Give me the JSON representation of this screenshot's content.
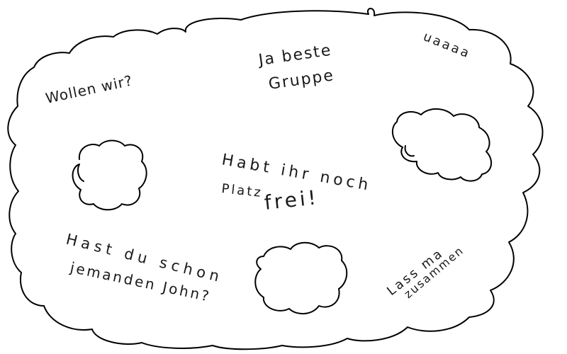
{
  "canvas": {
    "background": "#ffffff",
    "stroke_color": "#000000",
    "ink_color": "#1a1a1a"
  },
  "notes": {
    "top_left": "Wollen wir?",
    "top_center_line1": "Ja beste",
    "top_center_line2": "Gruppe",
    "top_right": "uaaaa",
    "center_line1": "Habt ihr noch",
    "center_line2_a": "Platz",
    "center_line2_b": "frei!",
    "bottom_left_line1": "Hast du schon",
    "bottom_left_line2": "jemanden John?",
    "bottom_right_line1": "Lass ma",
    "bottom_right_line2": "zusammen"
  }
}
